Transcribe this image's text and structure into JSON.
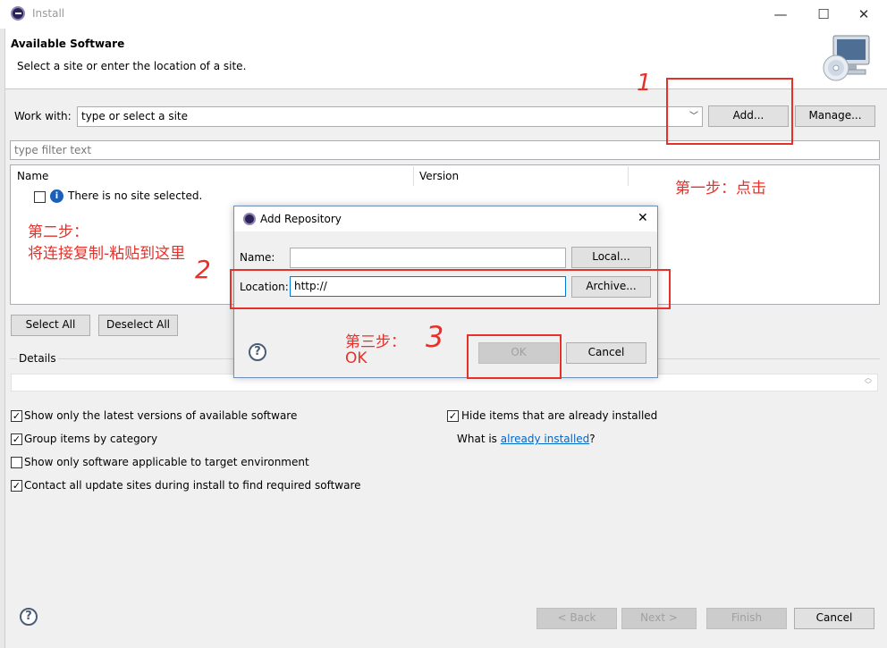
{
  "window": {
    "title": "Install",
    "minimize": "—",
    "maximize": "☐",
    "close": "✕"
  },
  "header": {
    "title": "Available Software",
    "description": "Select a site or enter the location of a site."
  },
  "work_with": {
    "label": "Work with:",
    "value": "type or select a site",
    "add": "Add...",
    "manage": "Manage..."
  },
  "filter": {
    "placeholder": "type filter text"
  },
  "table": {
    "columns": [
      "Name",
      "Version"
    ],
    "empty_row": "There is no site selected."
  },
  "list_buttons": {
    "select_all": "Select All",
    "deselect_all": "Deselect All"
  },
  "details": {
    "label": "Details"
  },
  "options": {
    "latest_only": "Show only the latest versions of available software",
    "group_by_category": "Group items by category",
    "target_env": "Show only software applicable to target environment",
    "contact_sites": "Contact all update sites during install to find required software",
    "hide_installed": "Hide items that are already installed",
    "what_is_prefix": "What is ",
    "already_installed_link": "already installed",
    "what_is_suffix": "?"
  },
  "footer": {
    "back": "< Back",
    "next": "Next >",
    "finish": "Finish",
    "cancel": "Cancel"
  },
  "dialog": {
    "title": "Add Repository",
    "close": "✕",
    "name_label": "Name:",
    "name_value": "",
    "local": "Local...",
    "location_label": "Location:",
    "location_value": "http://",
    "archive": "Archive...",
    "ok": "OK",
    "cancel": "Cancel"
  },
  "annotations": {
    "num1": "1",
    "num2": "2",
    "num3": "3",
    "step1": "第一步：点击",
    "step2_line1": "第二步：",
    "step2_line2": "将连接复制-粘贴到这里",
    "step3_line1": "第三步：",
    "step3_line2": "OK"
  },
  "colors": {
    "annotation_red": "#e8302a",
    "link_blue": "#0066cc",
    "focus_blue": "#0078d7"
  }
}
